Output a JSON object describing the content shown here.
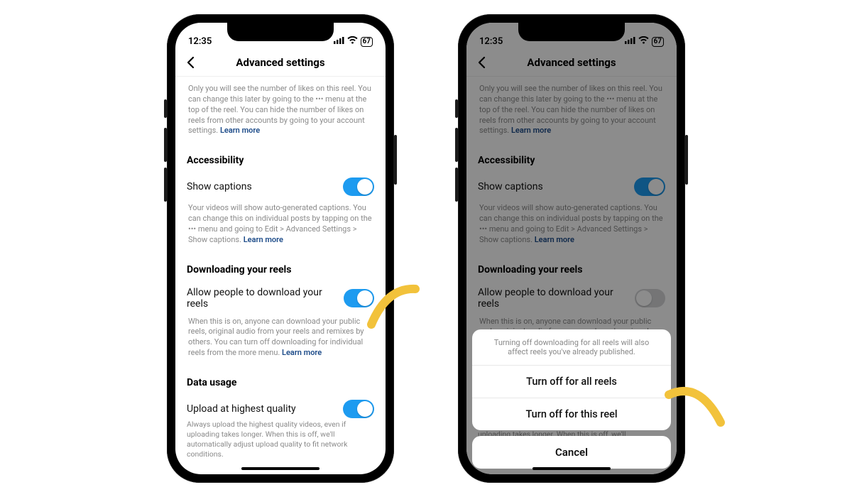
{
  "status": {
    "time": "12:35",
    "battery": "67"
  },
  "nav": {
    "title": "Advanced settings"
  },
  "likes_info": {
    "text": "Only you will see the number of likes on this reel. You can change this later by going to the ••• menu at the top of the reel. You can hide the number of likes on reels from other accounts by going to your account settings.",
    "learn": "Learn more"
  },
  "accessibility": {
    "heading": "Accessibility",
    "captions_label": "Show captions",
    "captions_desc": "Your videos will show auto-generated captions. You can change this on individual posts by tapping on the ••• menu and going to Edit > Advanced Settings > Show captions.",
    "learn": "Learn more"
  },
  "downloading": {
    "heading": "Downloading your reels",
    "allow_label": "Allow people to download your reels",
    "allow_desc": "When this is on, anyone can download your public reels, original audio from your reels and remixes by others. You can turn off downloading for individual reels from the more menu.",
    "learn": "Learn more"
  },
  "data_usage": {
    "heading": "Data usage",
    "upload_label": "Upload at highest quality",
    "upload_desc": "Always upload the highest quality videos, even if uploading takes longer. When this is off, we'll automatically adjust upload quality to fit network conditions."
  },
  "sheet": {
    "message": "Turning off downloading for all reels will also affect reels you've already published.",
    "opt_all": "Turn off for all reels",
    "opt_this": "Turn off for this reel",
    "cancel": "Cancel"
  }
}
